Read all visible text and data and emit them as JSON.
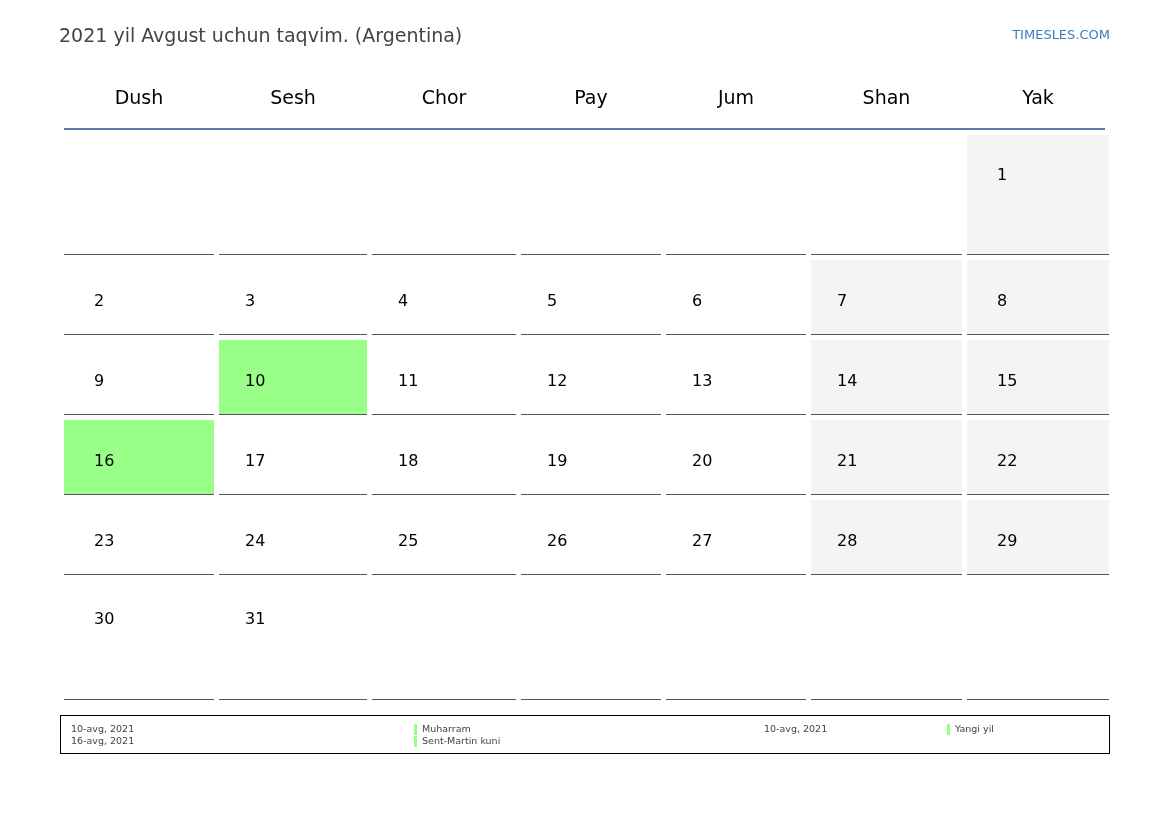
{
  "title": "2021 yil Avgust uchun taqvim. (Argentina)",
  "site_link": "TIMESLES.COM",
  "weekdays": [
    "Dush",
    "Sesh",
    "Chor",
    "Pay",
    "Jum",
    "Shan",
    "Yak"
  ],
  "weeks": [
    [
      {
        "kind": "empty"
      },
      {
        "kind": "empty"
      },
      {
        "kind": "empty"
      },
      {
        "kind": "empty"
      },
      {
        "kind": "empty"
      },
      {
        "kind": "empty"
      },
      {
        "kind": "weekend",
        "day": "1"
      }
    ],
    [
      {
        "kind": "day",
        "day": "2"
      },
      {
        "kind": "day",
        "day": "3"
      },
      {
        "kind": "day",
        "day": "4"
      },
      {
        "kind": "day",
        "day": "5"
      },
      {
        "kind": "day",
        "day": "6"
      },
      {
        "kind": "weekend",
        "day": "7"
      },
      {
        "kind": "weekend",
        "day": "8"
      }
    ],
    [
      {
        "kind": "day",
        "day": "9"
      },
      {
        "kind": "holiday",
        "day": "10"
      },
      {
        "kind": "day",
        "day": "11"
      },
      {
        "kind": "day",
        "day": "12"
      },
      {
        "kind": "day",
        "day": "13"
      },
      {
        "kind": "weekend",
        "day": "14"
      },
      {
        "kind": "weekend",
        "day": "15"
      }
    ],
    [
      {
        "kind": "holiday",
        "day": "16"
      },
      {
        "kind": "day",
        "day": "17"
      },
      {
        "kind": "day",
        "day": "18"
      },
      {
        "kind": "day",
        "day": "19"
      },
      {
        "kind": "day",
        "day": "20"
      },
      {
        "kind": "weekend",
        "day": "21"
      },
      {
        "kind": "weekend",
        "day": "22"
      }
    ],
    [
      {
        "kind": "day",
        "day": "23"
      },
      {
        "kind": "day",
        "day": "24"
      },
      {
        "kind": "day",
        "day": "25"
      },
      {
        "kind": "day",
        "day": "26"
      },
      {
        "kind": "day",
        "day": "27"
      },
      {
        "kind": "weekend",
        "day": "28"
      },
      {
        "kind": "weekend",
        "day": "29"
      }
    ],
    [
      {
        "kind": "day",
        "day": "30"
      },
      {
        "kind": "day",
        "day": "31"
      },
      {
        "kind": "empty"
      },
      {
        "kind": "empty"
      },
      {
        "kind": "empty"
      },
      {
        "kind": "empty"
      },
      {
        "kind": "empty"
      }
    ]
  ],
  "legend": [
    {
      "items": [
        {
          "date": "10-avg, 2021",
          "name": "Muharram",
          "color": "#99ff88"
        },
        {
          "date": "16-avg, 2021",
          "name": "Sent-Martin kuni",
          "color": "#99ff88"
        }
      ]
    },
    {
      "items": [
        {
          "date": "10-avg, 2021",
          "name": "Yangi yil",
          "color": "#99ff88"
        }
      ]
    }
  ]
}
